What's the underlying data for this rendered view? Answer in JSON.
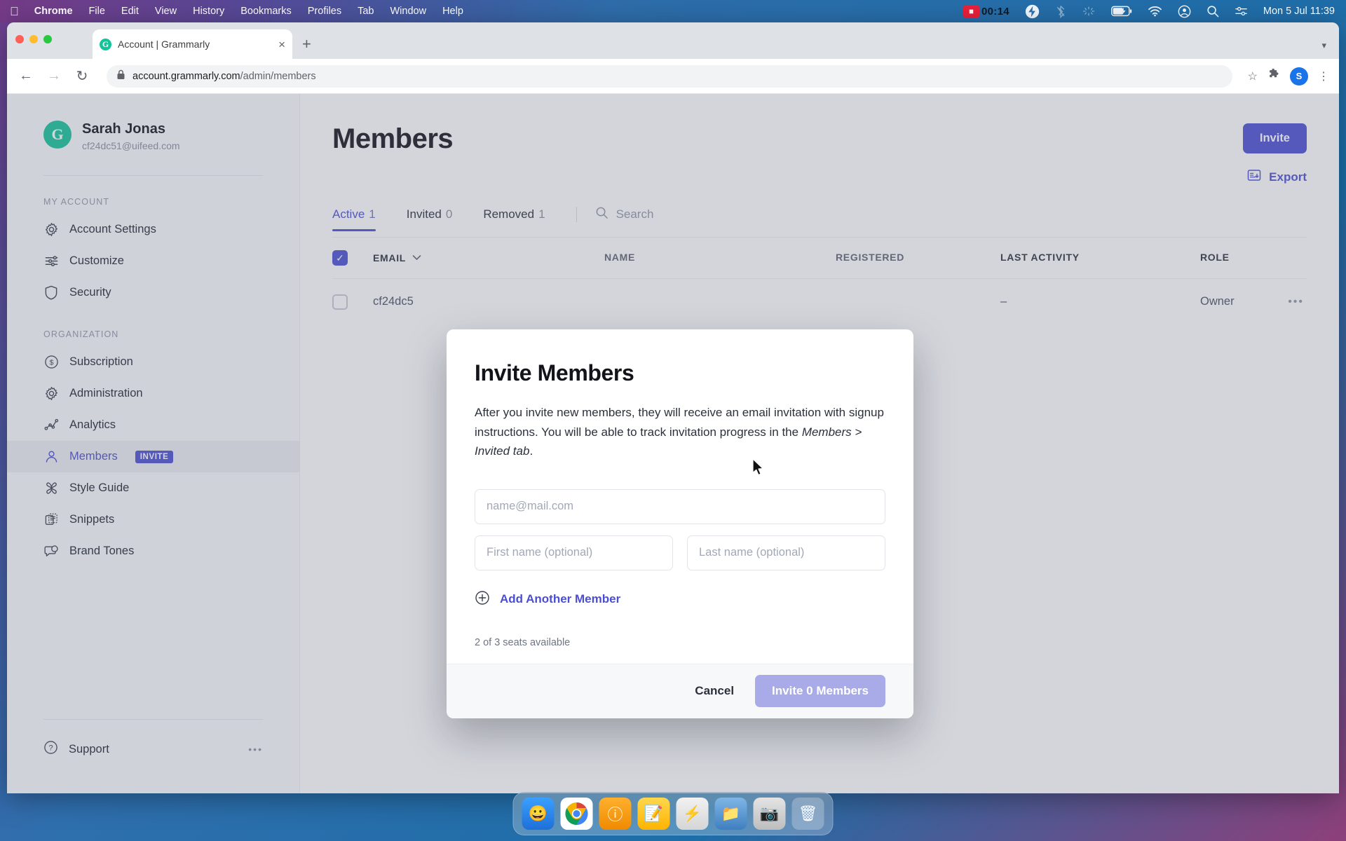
{
  "menubar": {
    "apple": "",
    "items": [
      {
        "label": "Chrome",
        "bold": true
      },
      {
        "label": "File",
        "bold": false
      },
      {
        "label": "Edit",
        "bold": false
      },
      {
        "label": "View",
        "bold": false
      },
      {
        "label": "History",
        "bold": false
      },
      {
        "label": "Bookmarks",
        "bold": false
      },
      {
        "label": "Profiles",
        "bold": false
      },
      {
        "label": "Tab",
        "bold": false
      },
      {
        "label": "Window",
        "bold": false
      },
      {
        "label": "Help",
        "bold": false
      }
    ],
    "recording_time": "00:14",
    "clock": "Mon 5 Jul  11:39"
  },
  "browser": {
    "tab_title": "Account | Grammarly",
    "tab_favicon_letter": "G",
    "tab_close": "×",
    "new_tab": "+",
    "back": "←",
    "forward": "→",
    "reload": "↻",
    "lock_icon": "lock-icon",
    "url_domain": "account.grammarly.com",
    "url_path": "/admin/members",
    "star": "☆",
    "extensions": "🧩",
    "profile_letter": "S",
    "menu": "⋮",
    "tabstrip_chevron": "▾"
  },
  "sidebar": {
    "profile": {
      "avatar_letter": "G",
      "name": "Sarah Jonas",
      "email": "cf24dc51@uifeed.com"
    },
    "sections": [
      {
        "label": "MY ACCOUNT",
        "items": [
          {
            "label": "Account Settings",
            "icon": "gear-icon",
            "active": false,
            "badge": ""
          },
          {
            "label": "Customize",
            "icon": "sliders-icon",
            "active": false,
            "badge": ""
          },
          {
            "label": "Security",
            "icon": "shield-icon",
            "active": false,
            "badge": ""
          }
        ]
      },
      {
        "label": "ORGANIZATION",
        "items": [
          {
            "label": "Subscription",
            "icon": "dollar-circle-icon",
            "active": false,
            "badge": ""
          },
          {
            "label": "Administration",
            "icon": "gear-icon",
            "active": false,
            "badge": ""
          },
          {
            "label": "Analytics",
            "icon": "analytics-icon",
            "active": false,
            "badge": ""
          },
          {
            "label": "Members",
            "icon": "person-icon",
            "active": true,
            "badge": "INVITE"
          },
          {
            "label": "Style Guide",
            "icon": "style-guide-icon",
            "active": false,
            "badge": ""
          },
          {
            "label": "Snippets",
            "icon": "snippets-icon",
            "active": false,
            "badge": ""
          },
          {
            "label": "Brand Tones",
            "icon": "brand-tones-icon",
            "active": false,
            "badge": ""
          }
        ]
      }
    ],
    "support": {
      "label": "Support",
      "icon": "question-circle-icon",
      "dots": "•••"
    }
  },
  "main": {
    "title": "Members",
    "invite_button": "Invite",
    "export_label": "Export",
    "export_icon": "export-icon",
    "tabs": [
      {
        "label": "Active",
        "count": "1",
        "selected": true
      },
      {
        "label": "Invited",
        "count": "0",
        "selected": false
      },
      {
        "label": "Removed",
        "count": "1",
        "selected": false
      }
    ],
    "search_placeholder": "Search",
    "search_icon": "search-icon",
    "table": {
      "headers": [
        "EMAIL",
        "NAME",
        "REGISTERED",
        "LAST ACTIVITY",
        "ROLE"
      ],
      "header_sort_icon": "chevron-down-icon",
      "header_checkbox_checked": true,
      "rows": [
        {
          "checked": false,
          "email": "cf24dc5",
          "name": "",
          "registered": "",
          "last_activity": "–",
          "role": "Owner",
          "menu": "•••"
        }
      ]
    }
  },
  "modal": {
    "title": "Invite Members",
    "description_part1": "After you invite new members, they will receive an email invitation with signup instructions. You will be able to track invitation progress in the ",
    "description_italic": "Members > Invited tab",
    "description_part2": ".",
    "email_placeholder": "name@mail.com",
    "email_value": "",
    "first_name_placeholder": "First name (optional)",
    "first_name_value": "",
    "last_name_placeholder": "Last name (optional)",
    "last_name_value": "",
    "add_another_label": "Add Another Member",
    "add_another_icon": "plus-circle-icon",
    "seats_text": "2 of 3 seats available",
    "cancel_label": "Cancel",
    "submit_label": "Invite 0 Members"
  },
  "dock": {
    "apps": [
      "finder-icon",
      "chrome-icon",
      "info-icon",
      "notes-icon",
      "lightning-icon",
      "folder-icon",
      "screenshot-icon",
      "trash-icon"
    ]
  },
  "colors": {
    "brand_purple": "#4a4ed1",
    "grammarly_green": "#15c39a",
    "overlay": "rgba(108,117,137,0.30)"
  }
}
